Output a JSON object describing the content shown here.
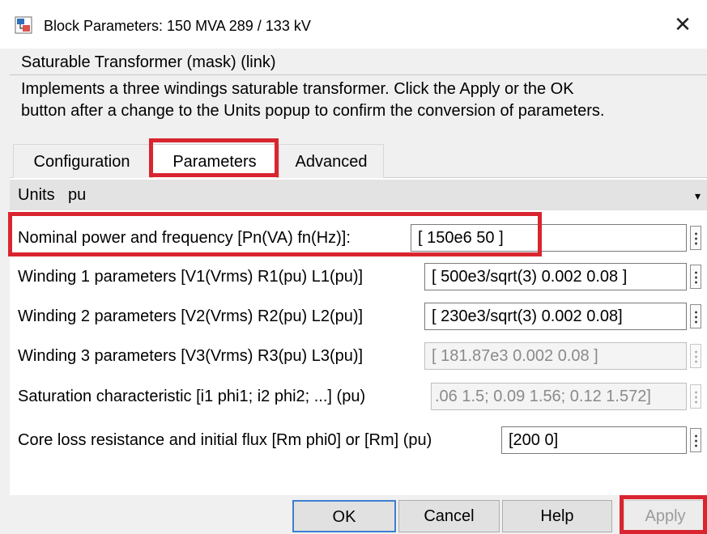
{
  "window": {
    "title": "Block Parameters: 150 MVA 289 / 133 kV",
    "close_glyph": "✕",
    "icon": "simulink-block-icon"
  },
  "mask_type": "Saturable Transformer (mask) (link)",
  "description_lines": [
    "Implements a three windings saturable transformer. Click the Apply or the OK",
    "button after a change to the Units popup to confirm the conversion of parameters."
  ],
  "tabs": [
    {
      "label": "Configuration",
      "selected": false
    },
    {
      "label": "Parameters",
      "selected": true
    },
    {
      "label": "Advanced",
      "selected": false
    }
  ],
  "units": {
    "label": "Units",
    "value": "pu",
    "arrow": "▾"
  },
  "parameters": [
    {
      "label": "Nominal power and frequency [Pn(VA) fn(Hz)]:",
      "value": "[ 150e6 50 ]",
      "enabled": true
    },
    {
      "label": "Winding 1 parameters [V1(Vrms) R1(pu) L1(pu)]",
      "value": "[ 500e3/sqrt(3) 0.002 0.08 ]",
      "enabled": true
    },
    {
      "label": "Winding 2 parameters [V2(Vrms) R2(pu) L2(pu)]",
      "value": "[ 230e3/sqrt(3) 0.002 0.08]",
      "enabled": true
    },
    {
      "label": "Winding 3 parameters [V3(Vrms) R3(pu) L3(pu)]",
      "value": "[ 181.87e3  0.002  0.08 ]",
      "enabled": false
    },
    {
      "label": "Saturation characteristic [i1 phi1; i2 phi2; ...] (pu)",
      "value": ".06 1.5; 0.09 1.56; 0.12 1.572]",
      "enabled": false
    },
    {
      "label": "Core loss resistance and initial flux [Rm phi0] or [Rm] (pu)",
      "value": "[200 0]",
      "enabled": true
    }
  ],
  "buttons": {
    "ok": "OK",
    "cancel": "Cancel",
    "help": "Help",
    "apply": "Apply"
  },
  "colors": {
    "highlight": "#d9252f",
    "focus": "#3c7fd1"
  }
}
